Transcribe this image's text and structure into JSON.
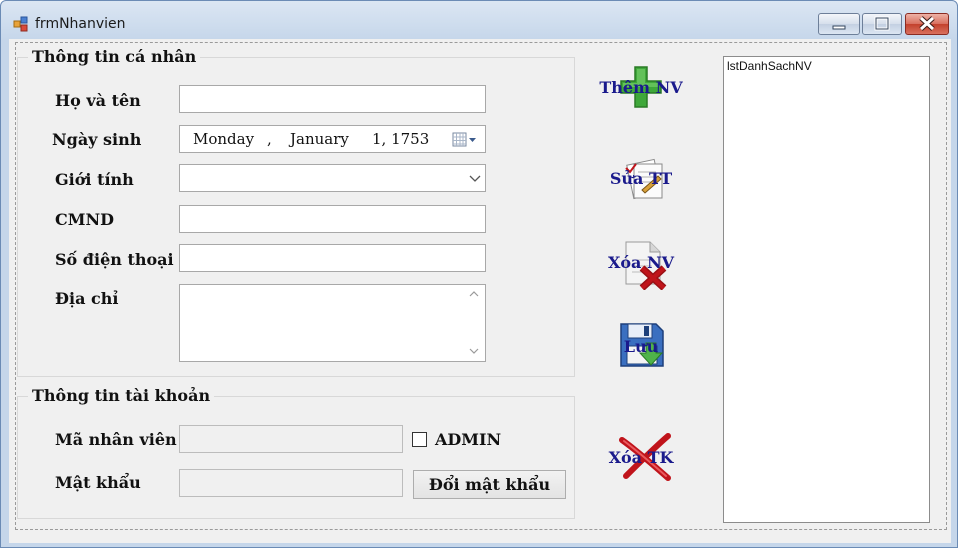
{
  "window": {
    "title": "frmNhanvien",
    "icon": "form-icon"
  },
  "personal": {
    "group_title": "Thông tin cá nhân",
    "name_label": "Họ và tên",
    "name_value": "",
    "dob_label": "Ngày sinh",
    "dob_day": "Monday",
    "dob_sep1": ",",
    "dob_month": "January",
    "dob_dayyear": "1, 1753",
    "gender_label": "Giới tính",
    "gender_value": "",
    "id_label": "CMND",
    "id_value": "",
    "phone_label": "Số điện thoại",
    "phone_value": "",
    "address_label": "Địa chỉ",
    "address_value": ""
  },
  "account": {
    "group_title": "Thông tin tài khoản",
    "empid_label": "Mã nhân viên",
    "empid_value": "",
    "admin_label": "ADMIN",
    "admin_checked": false,
    "password_label": "Mật khẩu",
    "password_value": "",
    "change_password_label": "Đổi mật khẩu"
  },
  "actions": {
    "add_label": "Thêm NV",
    "add_icon": "plus-icon",
    "edit_label": "Sửa TT",
    "edit_icon": "edit-document-icon",
    "delete_label": "Xóa NV",
    "delete_icon": "delete-document-icon",
    "save_label": "Lưu",
    "save_icon": "floppy-disk-icon",
    "delete_account_label": "Xóa TK",
    "delete_account_icon": "red-x-icon"
  },
  "list": {
    "name": "lstDanhSachNV"
  },
  "colors": {
    "action_text": "#1a1a8c",
    "plus_green": "#3fa83a",
    "x_red": "#c0141b",
    "window_frame": "#c5d6ea"
  }
}
